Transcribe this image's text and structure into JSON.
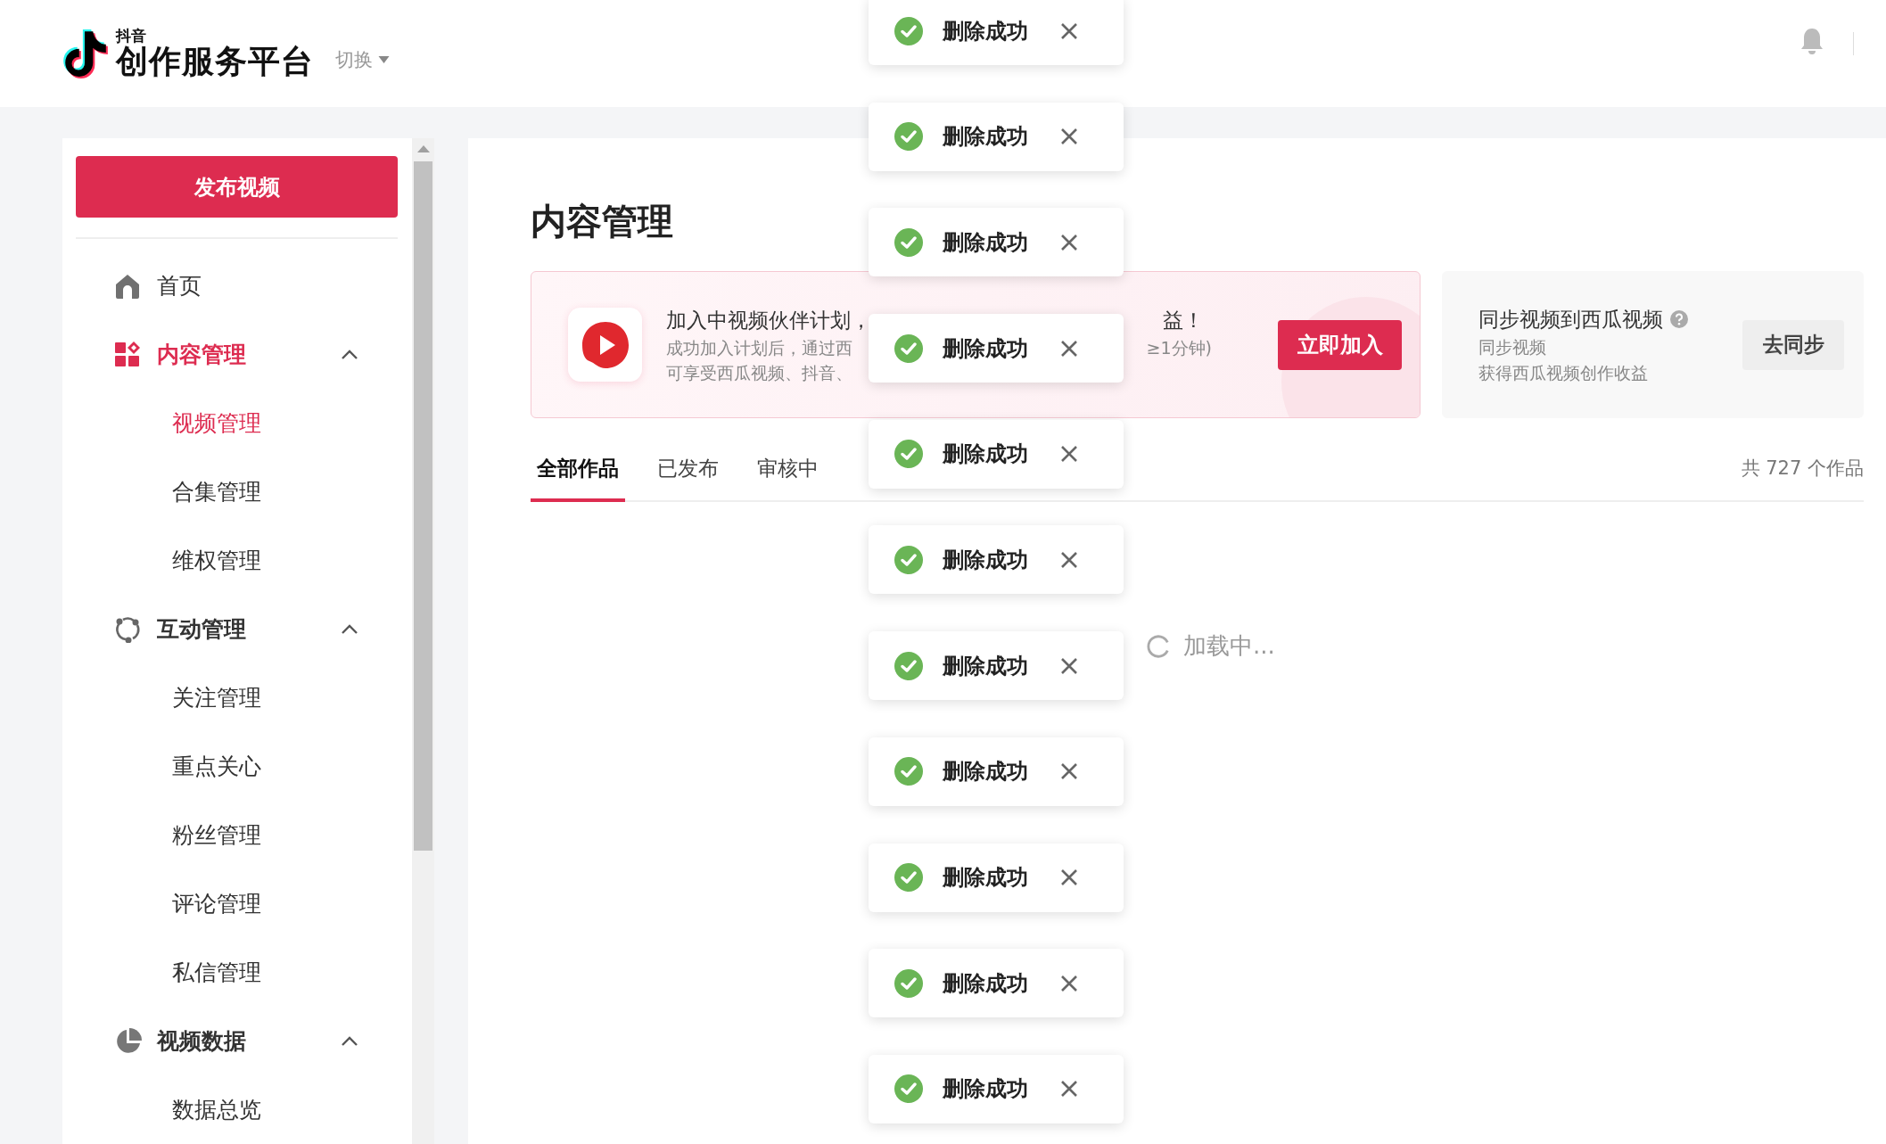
{
  "header": {
    "logo_small": "抖音",
    "logo_title": "创作服务平台",
    "switch": "切换"
  },
  "sidebar": {
    "publish_button": "发布视频",
    "items": [
      {
        "label": "首页",
        "selected": false
      },
      {
        "label": "内容管理",
        "selected": true,
        "expanded": true,
        "children": [
          {
            "label": "视频管理",
            "selected": true
          },
          {
            "label": "合集管理",
            "selected": false
          },
          {
            "label": "维权管理",
            "selected": false
          }
        ]
      },
      {
        "label": "互动管理",
        "selected": false,
        "expanded": true,
        "children": [
          {
            "label": "关注管理",
            "selected": false
          },
          {
            "label": "重点关心",
            "selected": false
          },
          {
            "label": "粉丝管理",
            "selected": false
          },
          {
            "label": "评论管理",
            "selected": false
          },
          {
            "label": "私信管理",
            "selected": false
          }
        ]
      },
      {
        "label": "视频数据",
        "selected": false,
        "expanded": true,
        "children": [
          {
            "label": "数据总览",
            "selected": false
          }
        ]
      }
    ]
  },
  "main": {
    "title": "内容管理",
    "banner": {
      "headline_start": "加入中视频伙伴计划，",
      "headline_end": "益！",
      "line_1_start": "成功加入计划后，通过西",
      "line_1_end": "≥1分钟)",
      "line_2_start": "可享受西瓜视频、抖音、",
      "button": "立即加入"
    },
    "sync_card": {
      "title": "同步视频到西瓜视频",
      "line_1": "同步视频",
      "line_2": "获得西瓜视频创作收益",
      "button": "去同步"
    },
    "tabs": [
      {
        "label": "全部作品",
        "selected": true
      },
      {
        "label": "已发布",
        "selected": false
      },
      {
        "label": "审核中",
        "selected": false
      }
    ],
    "count": "共 727 个作品",
    "loading": "加载中..."
  },
  "toasts": [
    {
      "message": "删除成功"
    },
    {
      "message": "删除成功"
    },
    {
      "message": "删除成功"
    },
    {
      "message": "删除成功"
    },
    {
      "message": "删除成功"
    },
    {
      "message": "删除成功"
    },
    {
      "message": "删除成功"
    },
    {
      "message": "删除成功"
    },
    {
      "message": "删除成功"
    },
    {
      "message": "删除成功"
    },
    {
      "message": "删除成功"
    }
  ]
}
